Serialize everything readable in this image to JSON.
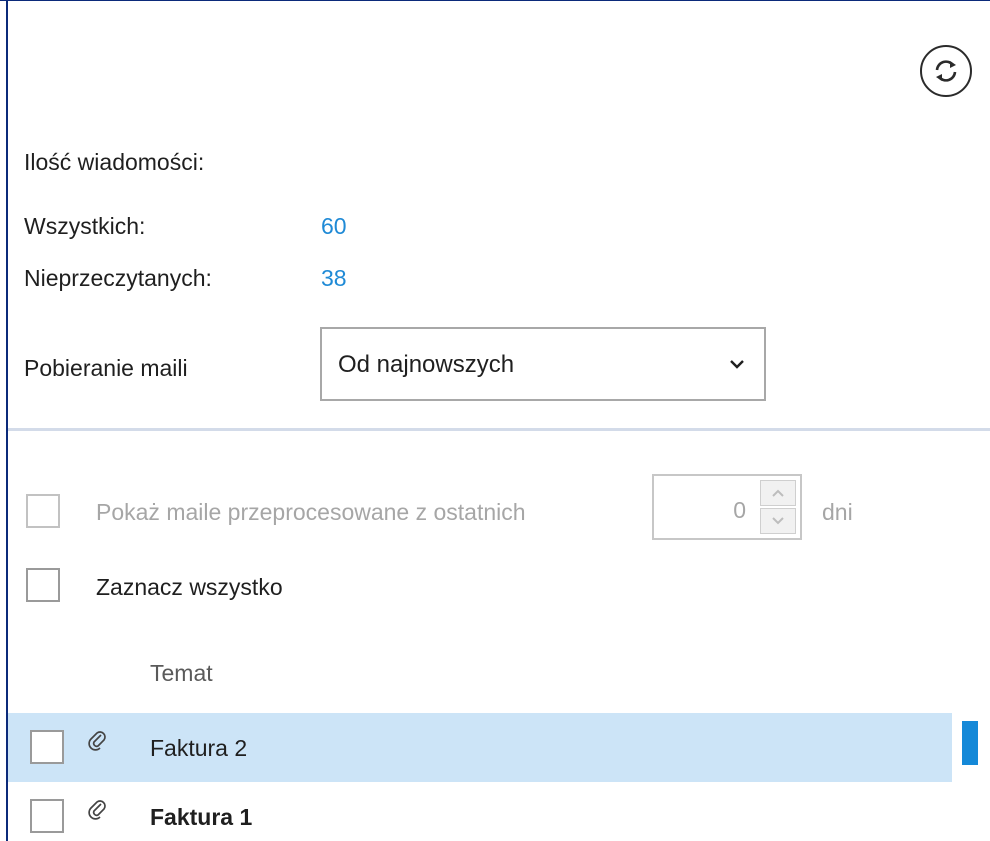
{
  "refresh": {
    "icon": "refresh-icon"
  },
  "stats": {
    "heading": "Ilość wiadomości:",
    "all_label": "Wszystkich:",
    "all_value": "60",
    "unread_label": "Nieprzeczytanych:",
    "unread_value": "38"
  },
  "fetch": {
    "label": "Pobieranie maili",
    "selected": "Od najnowszych"
  },
  "filter": {
    "show_processed_label": "Pokaż maile przeprocesowane z ostatnich",
    "days_value": "0",
    "days_unit": "dni",
    "checked": false
  },
  "select_all": {
    "label": "Zaznacz wszystko",
    "checked": false
  },
  "table": {
    "column_header": "Temat",
    "rows": [
      {
        "subject": "Faktura 2",
        "has_attachment": true,
        "selected": true,
        "unread": false
      },
      {
        "subject": "Faktura 1",
        "has_attachment": true,
        "selected": false,
        "unread": true
      }
    ]
  },
  "colors": {
    "accent": "#1f8ad6",
    "selection_bg": "#cce4f7",
    "selection_indicator": "#1589d8",
    "frame": "#0b2a7a"
  }
}
